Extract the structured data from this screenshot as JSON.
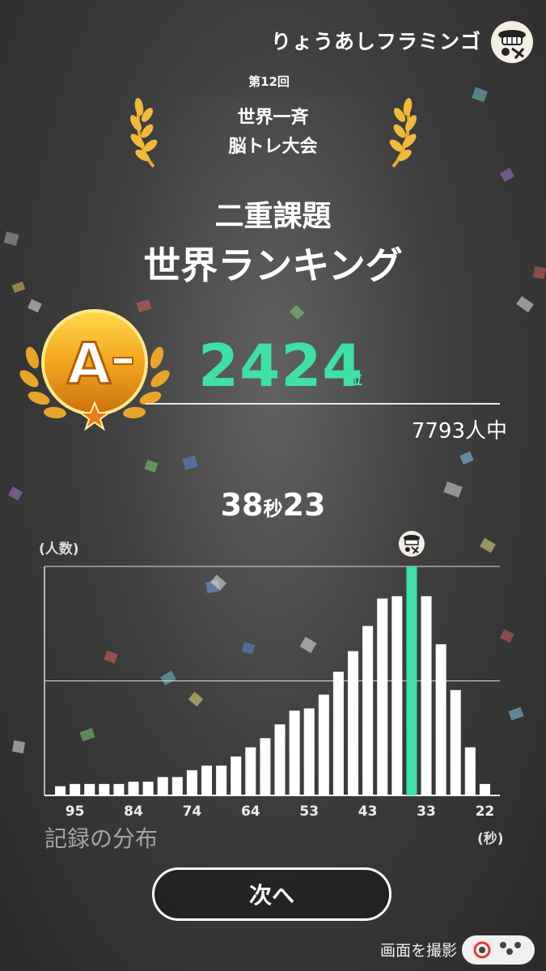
{
  "user": {
    "name": "りょうあしフラミンゴ"
  },
  "event": {
    "round": "第12回",
    "title_line1": "世界一斉",
    "title_line2": "脳トレ大会"
  },
  "mode": "二重課題",
  "ranking_title": "世界ランキング",
  "rank": {
    "grade": "A-",
    "number": "2424",
    "suffix": "位",
    "participants": "7793人中"
  },
  "time": {
    "seconds": "38",
    "sec_unit": "秒",
    "hundredths": "23"
  },
  "chart_data": {
    "type": "bar",
    "title": "記録の分布",
    "ylabel": "(人数)",
    "xlabel": "(秒)",
    "x_tick_labels": [
      "95",
      "84",
      "74",
      "64",
      "53",
      "43",
      "33",
      "22"
    ],
    "values": [
      4,
      5,
      5,
      5,
      5,
      6,
      6,
      8,
      8,
      11,
      13,
      13,
      17,
      21,
      25,
      31,
      37,
      38,
      44,
      54,
      63,
      74,
      86,
      87,
      100,
      87,
      66,
      46,
      21,
      5
    ],
    "highlight_index": 24,
    "ylim": [
      0,
      100
    ],
    "colors": {
      "bar": "#ffffff",
      "highlight": "#3fe0a5"
    }
  },
  "buttons": {
    "next": "次へ"
  },
  "footer": {
    "capture": "画面を撮影"
  }
}
